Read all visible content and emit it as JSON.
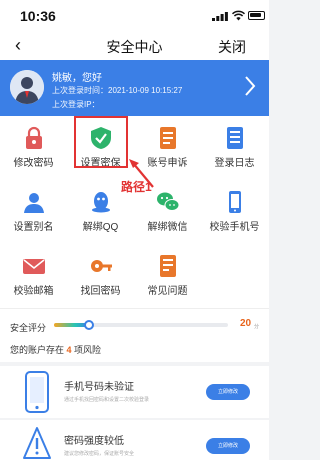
{
  "status_bar": {
    "time": "10:36"
  },
  "nav": {
    "back_glyph": "‹",
    "title": "安全中心",
    "close_label": "关闭"
  },
  "account": {
    "greeting": "姚敏，您好",
    "last_login_time": "上次登录时间：2021-10-09 10:15:27",
    "last_login_ip": "上次登录IP："
  },
  "features": [
    {
      "label": "修改密码",
      "icon": "lock-icon",
      "color": "#e05a5a"
    },
    {
      "label": "设置密保",
      "icon": "shield-check-icon",
      "color": "#2db36b"
    },
    {
      "label": "账号申诉",
      "icon": "document-icon",
      "color": "#e8772b"
    },
    {
      "label": "登录日志",
      "icon": "log-icon",
      "color": "#3b7fe6"
    },
    {
      "label": "设置别名",
      "icon": "user-icon",
      "color": "#3b7fe6"
    },
    {
      "label": "解绑QQ",
      "icon": "qq-icon",
      "color": "#3b7fe6"
    },
    {
      "label": "解绑微信",
      "icon": "wechat-icon",
      "color": "#2db36b"
    },
    {
      "label": "校验手机号",
      "icon": "phone-icon",
      "color": "#3b7fe6"
    },
    {
      "label": "校验邮箱",
      "icon": "mail-icon",
      "color": "#e05a5a"
    },
    {
      "label": "找回密码",
      "icon": "key-icon",
      "color": "#e8772b"
    },
    {
      "label": "常见问题",
      "icon": "faq-icon",
      "color": "#e8772b"
    }
  ],
  "annotation": {
    "path_label": "路径1"
  },
  "security": {
    "score_label": "安全评分",
    "score": "20",
    "score_unit": "分",
    "score_fraction": 0.2,
    "risk_prefix": "您的账户存在 ",
    "risk_count": "4",
    "risk_suffix": " 项风险"
  },
  "risks": [
    {
      "title": "手机号码未验证",
      "desc": "通过手机找回密码和设置二次校验登录",
      "button": "立即修改",
      "icon": "mobile-phone-icon"
    },
    {
      "title": "密码强度较低",
      "desc": "建议您修改密码，保证账号安全",
      "button": "立即修改",
      "icon": "warning-icon"
    }
  ],
  "colors": {
    "brand_blue": "#3b7fe6",
    "alert_red": "#e23333",
    "score_orange": "#e8651d"
  }
}
